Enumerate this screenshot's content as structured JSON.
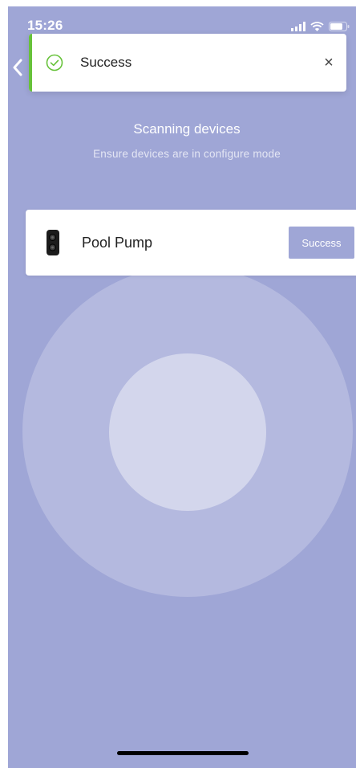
{
  "status_bar": {
    "time": "15:26"
  },
  "toast": {
    "message": "Success",
    "close_symbol": "×",
    "icon": "check-circle-icon",
    "accent_color": "#67c23a"
  },
  "scan": {
    "title": "Scanning devices",
    "subtitle": "Ensure devices are in configure mode"
  },
  "devices": [
    {
      "name": "Pool Pump",
      "status": "Success",
      "icon": "pool-pump-device-icon"
    }
  ],
  "colors": {
    "background": "#9fa6d6",
    "status_button": "#9fa6d6"
  }
}
